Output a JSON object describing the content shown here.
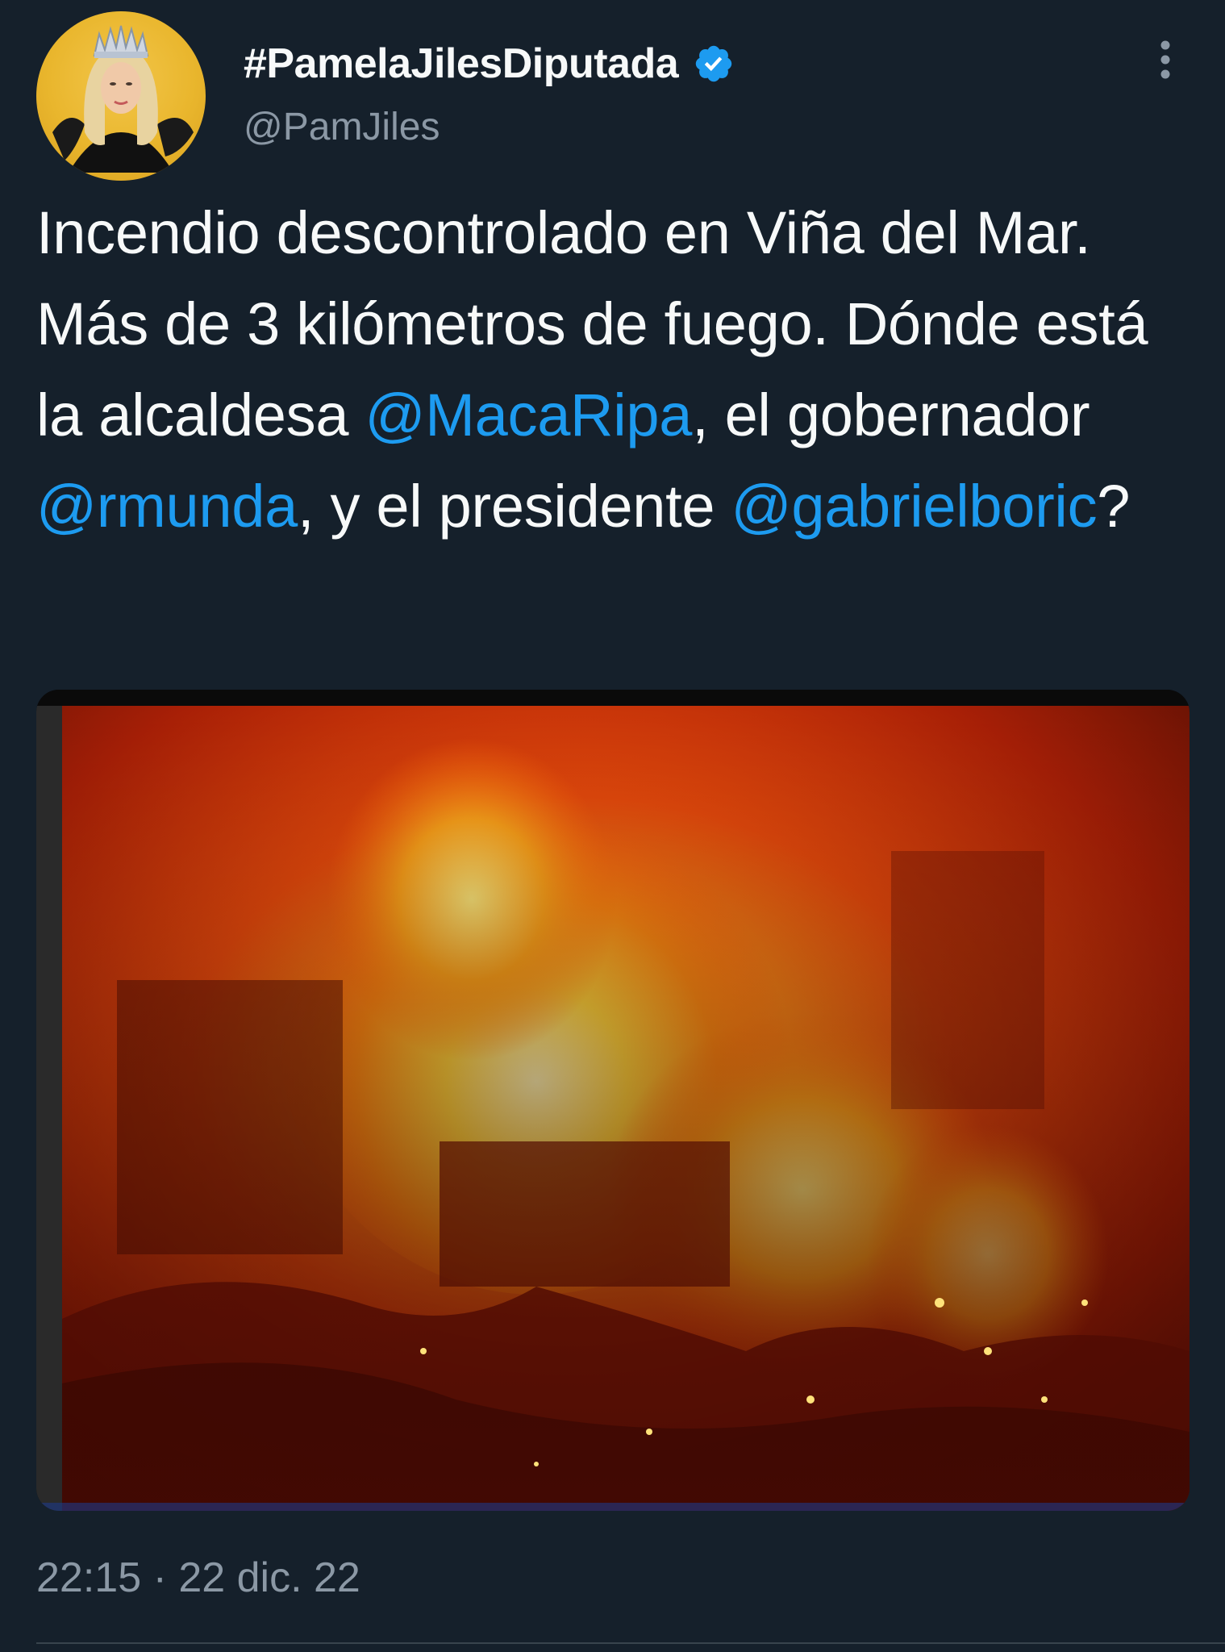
{
  "user": {
    "display_name": "#PamelaJilesDiputada",
    "handle": "@PamJiles",
    "verified": true,
    "avatar_icon": "profile-photo"
  },
  "tweet": {
    "segments": [
      {
        "text": "Incendio descontrolado en Viña del Mar. Más de 3 kilómetros de fuego. Dónde está la alcaldesa ",
        "type": "text"
      },
      {
        "text": "@MacaRipa",
        "type": "mention"
      },
      {
        "text": ", el gobernador ",
        "type": "text"
      },
      {
        "text": "@rmunda",
        "type": "mention"
      },
      {
        "text": ", y el presidente ",
        "type": "text"
      },
      {
        "text": "@gabrielboric",
        "type": "mention"
      },
      {
        "text": "?",
        "type": "text"
      }
    ],
    "timestamp": "22:15 · 22 dic. 22"
  },
  "colors": {
    "background": "#15202b",
    "text": "#f7f9f9",
    "secondary_text": "#8b98a5",
    "mention": "#1d9bf0",
    "verified_badge": "#1d9bf0"
  },
  "icons": {
    "verified": "verified-badge-icon",
    "more": "more-vertical-icon"
  }
}
